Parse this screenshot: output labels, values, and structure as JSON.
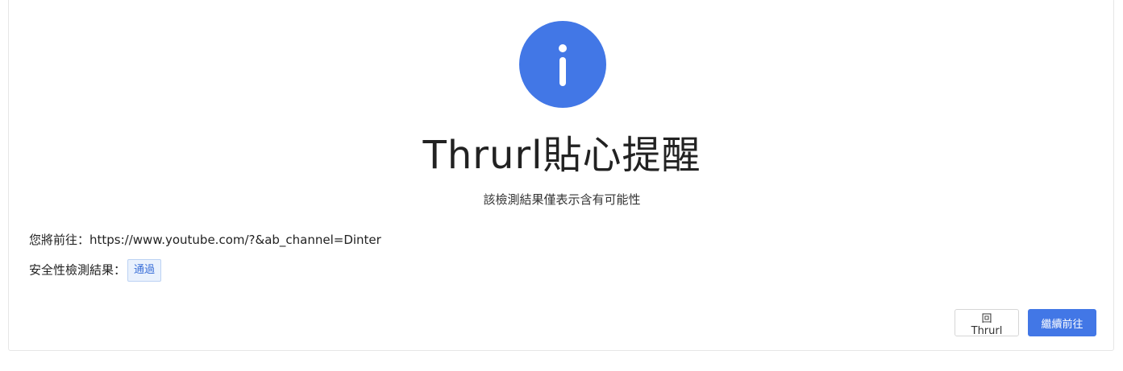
{
  "notice": {
    "icon": "info-icon",
    "title": "Thrurl貼心提醒",
    "subtitle": "該檢測結果僅表示含有可能性"
  },
  "destination": {
    "label": "您將前往：",
    "url": "https://www.youtube.com/?&ab_channel=Dinter"
  },
  "safety": {
    "label": "安全性檢測結果：",
    "result": "通過"
  },
  "actions": {
    "back_label": "回Thrurl",
    "continue_label": "繼續前往"
  },
  "colors": {
    "accent": "#4277e6",
    "badge_text": "#3a6fd8",
    "badge_bg": "#e9f1fd"
  }
}
